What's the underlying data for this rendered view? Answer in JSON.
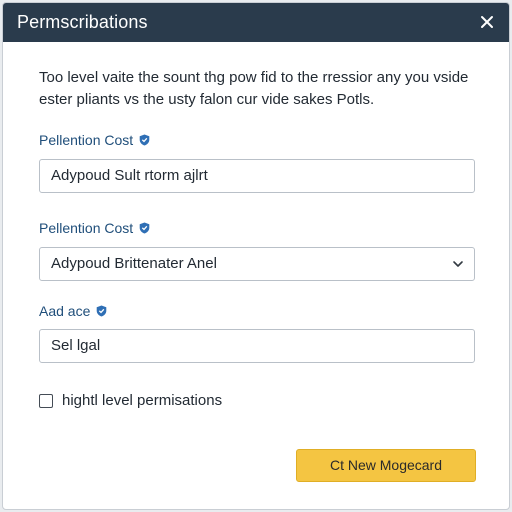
{
  "dialog": {
    "title": "Permscribations",
    "close_icon": "close-icon",
    "description": "Too level vaite the sount thg pow fid to the rressior any you vside ester pliants vs the usty falon cur vide sakes Potls.",
    "fields": [
      {
        "label": "Pellention Cost",
        "info_icon": "shield-info-icon",
        "type": "text",
        "value": "Adypoud Sult rtorm ajlrt"
      },
      {
        "label": "Pellention Cost",
        "info_icon": "shield-info-icon",
        "type": "select",
        "value": "Adypoud Brittenater Anel",
        "chevron_icon": "chevron-down-icon"
      },
      {
        "label": "Aad ace",
        "info_icon": "shield-info-icon",
        "type": "text",
        "value": "Sel lgal"
      }
    ],
    "checkbox": {
      "label": "hightl level permisations",
      "checked": false
    },
    "primary_button": {
      "label": "Ct New Mogecard"
    },
    "colors": {
      "titlebar": "#2a3b4c",
      "label_text": "#1f4e7a",
      "info_icon": "#2f6fb5",
      "primary_button": "#f4c542"
    }
  }
}
